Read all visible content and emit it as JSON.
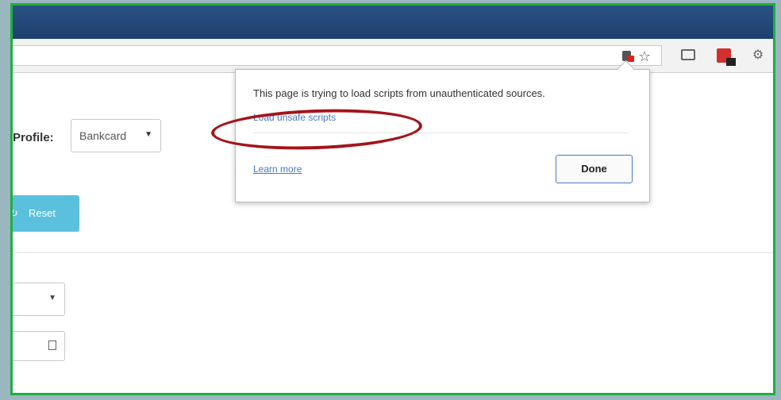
{
  "browser": {
    "icons": [
      "shield-blocked-icon",
      "star-icon",
      "cast-icon",
      "extension-red-icon",
      "extension-gear-icon"
    ],
    "star_glyph": "☆",
    "gear_glyph": "⚙"
  },
  "page": {
    "profile_label": "Profile:",
    "profile_value": "Bankcard",
    "reset_label": "Reset"
  },
  "popup": {
    "message": "This page is trying to load scripts from unauthenticated sources.",
    "load_link": "Load unsafe scripts",
    "learn_more": "Learn more",
    "done": "Done"
  },
  "colors": {
    "frame_border": "#1fae3f",
    "titlebar": "#2a5185",
    "reset_button": "#5bc0de",
    "link": "#4a78c2",
    "highlight": "#a3141b"
  }
}
